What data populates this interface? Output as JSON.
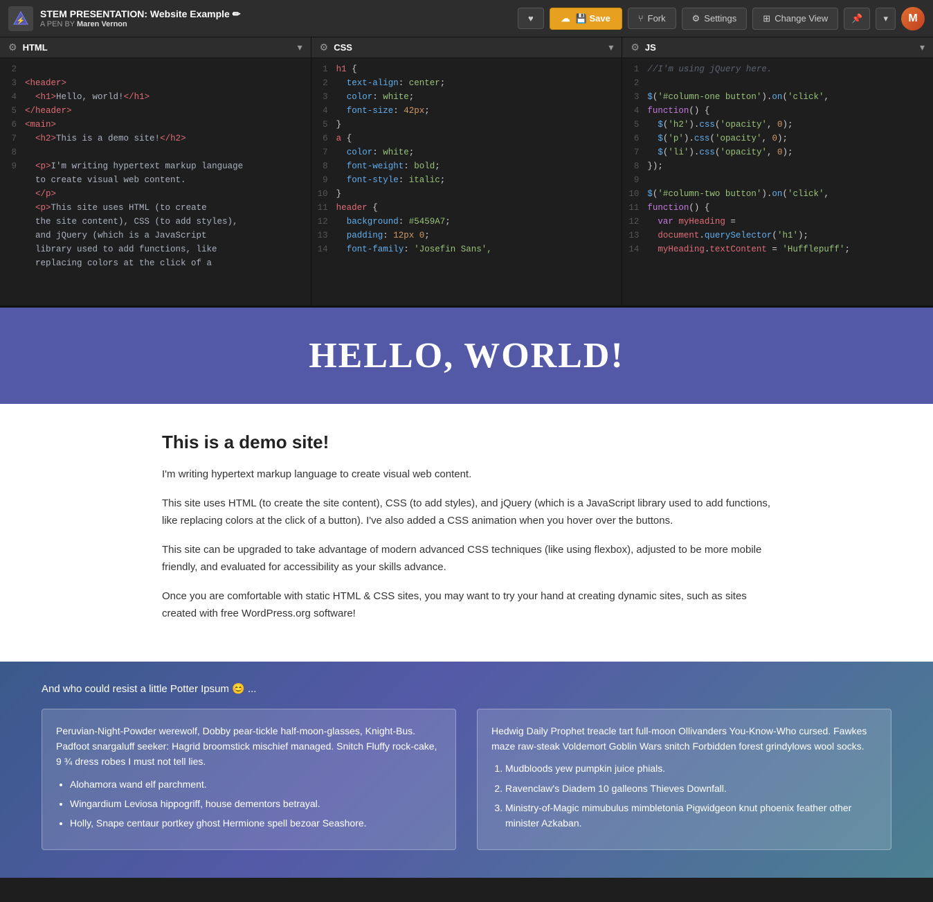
{
  "topbar": {
    "logo": "⚡",
    "title": "STEM PRESENTATION: Website Example ✏",
    "author_prefix": "A PEN BY",
    "author": "Maren Vernon",
    "btn_heart": "♥",
    "btn_save": "💾 Save",
    "btn_fork": "⑂ Fork",
    "btn_settings": "⚙ Settings",
    "btn_change_view": "⊞ Change View",
    "btn_pin": "📌",
    "btn_more": "▾"
  },
  "editors": {
    "html": {
      "lang": "HTML",
      "icon": "⚙"
    },
    "css": {
      "lang": "CSS",
      "icon": "⚙"
    },
    "js": {
      "lang": "JS",
      "icon": "⚙"
    }
  },
  "preview": {
    "header_text": "HELLO, WORLD!",
    "h2": "This is a demo site!",
    "p1": "I'm writing hypertext markup language to create visual web content.",
    "p2": "This site uses HTML (to create the site content), CSS (to add styles), and jQuery (which is a JavaScript library used to add functions, like replacing colors at the click of a button). I've also added a CSS animation when you hover over the buttons.",
    "p3": "This site can be upgraded to take advantage of modern advanced CSS techniques (like using flexbox), adjusted to be more mobile friendly, and evaluated for accessibility as your skills advance.",
    "p4": "Once you are comfortable with static HTML & CSS sites, you may want to try your hand at creating dynamic sites, such as sites created with free WordPress.org software!",
    "potter_label": "And who could resist a little Potter Ipsum 😊 ...",
    "col1_text": "Peruvian-Night-Powder werewolf, Dobby pear-tickle half-moon-glasses, Knight-Bus. Padfoot snargaluff seeker: Hagrid broomstick mischief managed. Snitch Fluffy rock-cake, 9 ¾ dress robes I must not tell lies.",
    "col1_items": [
      "Alohamora wand elf parchment.",
      "Wingardium Leviosa hippogriff, house dementors betrayal.",
      "Holly, Snape centaur portkey ghost Hermione spell bezoar Seashore."
    ],
    "col2_text": "Hedwig Daily Prophet treacle tart full-moon Ollivanders You-Know-Who cursed. Fawkes maze raw-steak Voldemort Goblin Wars snitch Forbidden forest grindylows wool socks.",
    "col2_items": [
      "Mudbloods yew pumpkin juice phials.",
      "Ravenclaw's Diadem 10 galleons Thieves Downfall.",
      "Ministry-of-Magic mimubulus mimbletonia Pigwidgeon knut phoenix feather other minister Azkaban."
    ]
  }
}
